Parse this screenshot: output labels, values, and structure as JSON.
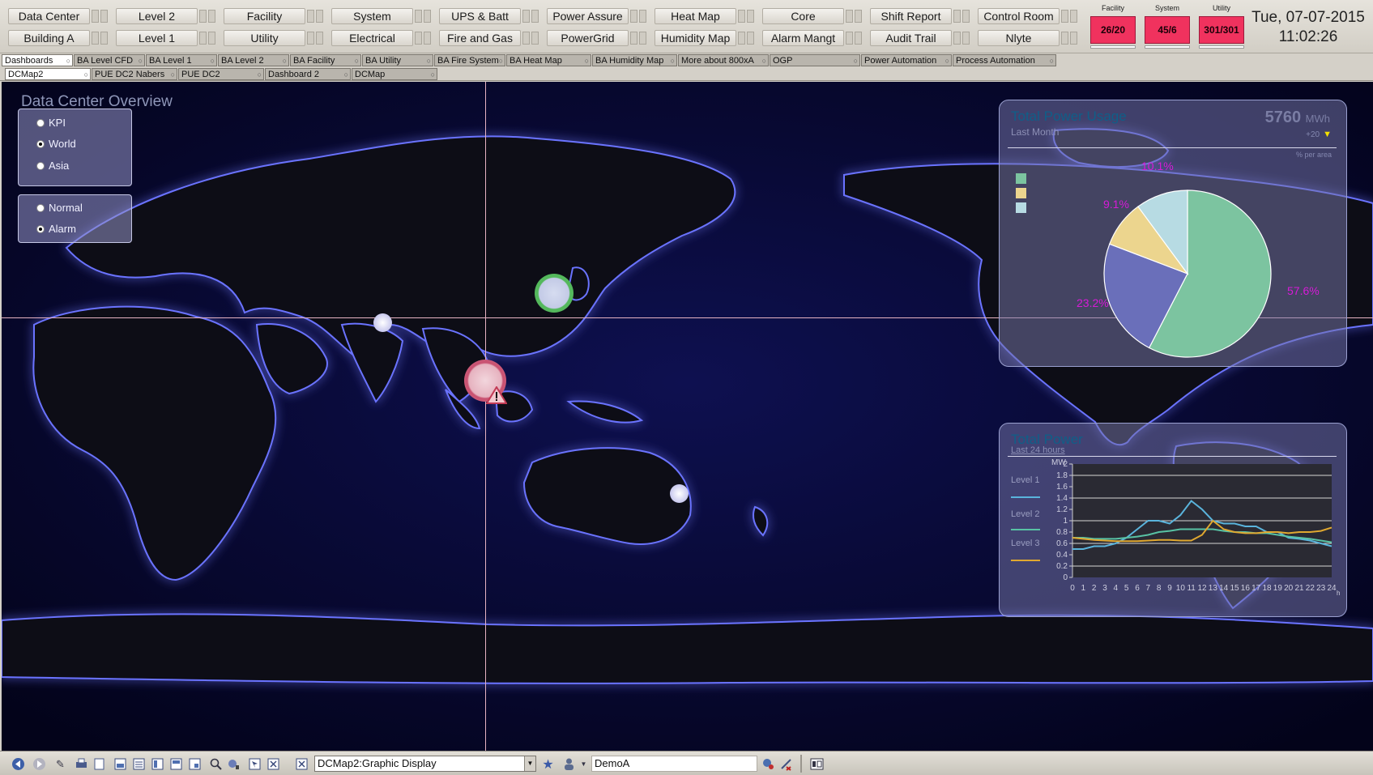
{
  "nav": {
    "row1": [
      "Data Center",
      "Level 2",
      "Facility",
      "System",
      "UPS & Batt",
      "Power Assure",
      "Heat Map",
      "Core",
      "Shift Report",
      "Control Room"
    ],
    "row2": [
      "Building A",
      "Level 1",
      "Utility",
      "Electrical",
      "Fire and Gas",
      "PowerGrid",
      "Humidity Map",
      "Alarm Mangt",
      "Audit Trail",
      "Nlyte"
    ]
  },
  "kpis": [
    {
      "label": "Facility",
      "value": "26/20"
    },
    {
      "label": "System",
      "value": "45/6"
    },
    {
      "label": "Utility",
      "value": "301/301"
    }
  ],
  "datetime": {
    "date": "Tue, 07-07-2015",
    "time": "11:02:26"
  },
  "tabs_row1": [
    "Dashboards",
    "BA Level CFD",
    "BA Level 1",
    "BA Level 2",
    "BA Facility",
    "BA Utility",
    "BA Fire System",
    "BA Heat Map",
    "BA Humidity Map",
    "More about 800xA",
    "OGP",
    "Power Automation",
    "Process Automation"
  ],
  "tabs_row2": [
    "DCMap2",
    "PUE DC2 Nabers",
    "PUE DC2",
    "Dashboard 2",
    "DCMap"
  ],
  "map": {
    "title": "Data Center Overview",
    "view_options": [
      {
        "label": "KPI",
        "selected": false
      },
      {
        "label": "World",
        "selected": true
      },
      {
        "label": "Asia",
        "selected": false
      }
    ],
    "mode_options": [
      {
        "label": "Normal",
        "selected": false
      },
      {
        "label": "Alarm",
        "selected": true
      }
    ]
  },
  "power_usage": {
    "title": "Total Power Usage",
    "subtitle": "Last Month",
    "total_value": "5760",
    "total_unit": "MWh",
    "delta": "+20",
    "per_area_label": "% per area",
    "colors": [
      "#7cc4a0",
      "#6a6fba",
      "#ecd58e",
      "#b7dbe3"
    ]
  },
  "total_power": {
    "title": "Total Power",
    "subtitle": "Last 24 hours",
    "y_unit": "MW",
    "x_unit": "h",
    "legend": [
      {
        "name": "Level 1",
        "color": "#5ab4dc"
      },
      {
        "name": "Level 2",
        "color": "#58c2a4"
      },
      {
        "name": "Level 3",
        "color": "#e0a830"
      }
    ]
  },
  "chart_data": [
    {
      "type": "pie",
      "categories": [
        "",
        "",
        "",
        ""
      ],
      "values": [
        57.6,
        23.2,
        9.1,
        10.1
      ],
      "labels": [
        "57.6%",
        "23.2%",
        "9.1%",
        "10.1%"
      ]
    },
    {
      "type": "line",
      "x": [
        0,
        1,
        2,
        3,
        4,
        5,
        6,
        7,
        8,
        9,
        10,
        11,
        12,
        13,
        14,
        15,
        16,
        17,
        18,
        19,
        20,
        21,
        22,
        23,
        24
      ],
      "x_tick_labels": [
        "0",
        "1",
        "2",
        "3",
        "4",
        "5",
        "6",
        "7",
        "8",
        "9",
        "10",
        "11",
        "12",
        "13",
        "14",
        "15",
        "16",
        "17",
        "18",
        "19",
        "20",
        "21",
        "22",
        "23",
        "24"
      ],
      "y_ticks": [
        0,
        0.2,
        0.4,
        0.6,
        0.8,
        1,
        1.2,
        1.4,
        1.6,
        1.8,
        2
      ],
      "y_tick_labels": [
        "0",
        "0.2",
        "0.4",
        "0.6",
        "0.8",
        "1",
        "1.2",
        "1.4",
        "1.6",
        "1.8",
        "2"
      ],
      "ylabel": "MW",
      "xlabel": "h",
      "ylim": [
        0,
        2
      ],
      "xlim": [
        0,
        24
      ],
      "grid": true,
      "series": [
        {
          "name": "Level 1",
          "values": [
            0.5,
            0.5,
            0.55,
            0.55,
            0.6,
            0.7,
            0.85,
            1.0,
            1.0,
            0.95,
            1.1,
            1.35,
            1.2,
            1.0,
            0.95,
            0.95,
            0.9,
            0.9,
            0.8,
            0.8,
            0.7,
            0.68,
            0.65,
            0.6,
            0.55
          ]
        },
        {
          "name": "Level 2",
          "values": [
            0.7,
            0.7,
            0.68,
            0.68,
            0.68,
            0.7,
            0.72,
            0.75,
            0.8,
            0.82,
            0.85,
            0.85,
            0.85,
            0.85,
            0.82,
            0.8,
            0.8,
            0.78,
            0.78,
            0.75,
            0.72,
            0.7,
            0.68,
            0.65,
            0.62
          ]
        },
        {
          "name": "Level 3",
          "values": [
            0.7,
            0.68,
            0.66,
            0.65,
            0.64,
            0.64,
            0.64,
            0.65,
            0.66,
            0.66,
            0.65,
            0.65,
            0.75,
            1.0,
            0.85,
            0.8,
            0.78,
            0.78,
            0.8,
            0.8,
            0.78,
            0.8,
            0.8,
            0.82,
            0.88
          ]
        }
      ]
    }
  ],
  "statusbar": {
    "display": "DCMap2:Graphic Display",
    "user": "DemoA"
  }
}
